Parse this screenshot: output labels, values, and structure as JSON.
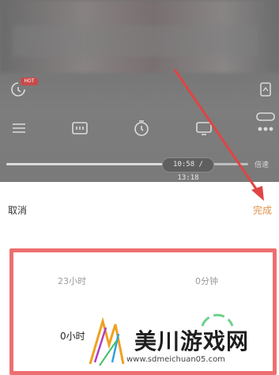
{
  "player": {
    "badge_text": "HOT",
    "time_display": "10:58 / 13:18",
    "speed_label": "倍速",
    "progress_fraction": 0.82,
    "icons": [
      "screen-lock-icon",
      "list-icon",
      "episode-icon",
      "timer-icon",
      "cast-icon",
      "more-icon",
      "mirror-icon"
    ]
  },
  "timer_sheet": {
    "cancel_label": "取消",
    "done_label": "完成",
    "done_color": "#e0914b",
    "hours_top": "23小时",
    "minutes_top": "0分钟",
    "hours_selected": "0小时"
  },
  "annotation": {
    "arrow_color": "#e04444",
    "box_color": "#ee6f6f"
  },
  "watermark": {
    "text": "美川游戏网",
    "url": "www.sdmeichuan05.com"
  }
}
